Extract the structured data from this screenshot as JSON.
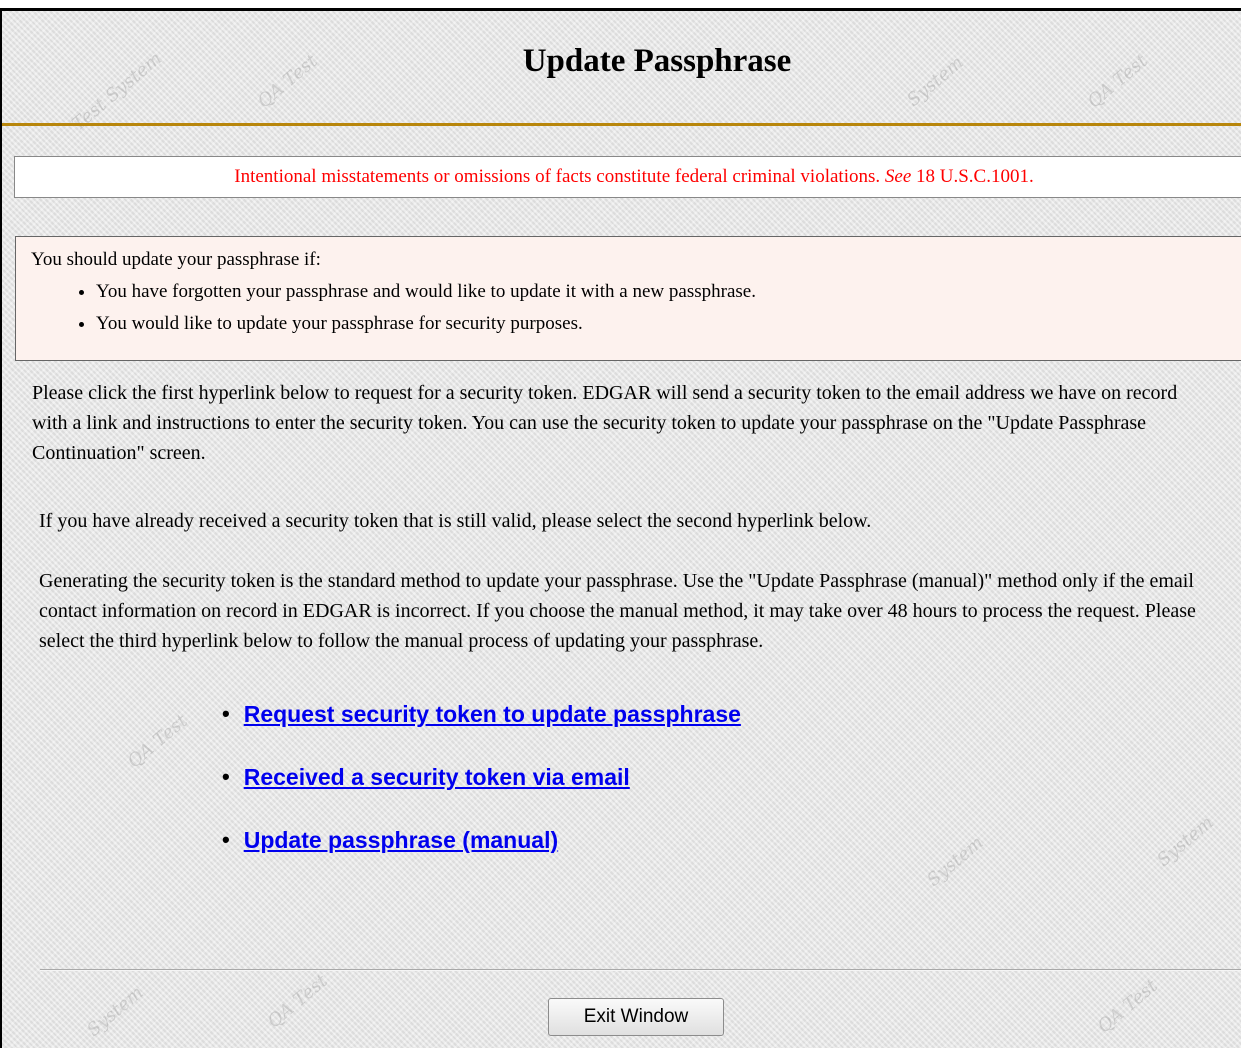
{
  "page": {
    "title": "Update Passphrase",
    "warning": {
      "text": "Intentional misstatements or omissions of facts constitute federal criminal violations. ",
      "see": "See",
      "citation": " 18 U.S.C.1001.",
      "color": "#ff0000"
    },
    "info": {
      "heading": "You should update your passphrase if:",
      "items": [
        "You have forgotten your passphrase and would like to update it with a new passphrase.",
        "You would like to update your passphrase for security purposes."
      ]
    },
    "paragraphs": {
      "p1": "Please click the first hyperlink below to request for a security token. EDGAR will send a security token to the email address we have on record with a link and instructions to enter the security token. You can use the security token to update your passphrase on the \"Update Passphrase Continuation\" screen.",
      "p2": "If you have already received a security token that is still valid, please select the second hyperlink below.",
      "p3": "Generating the security token is the standard method to update your passphrase. Use the \"Update Passphrase (manual)\" method only if the email contact information on record in EDGAR is incorrect. If you choose the manual method, it may take over 48 hours to process the request. Please select the third hyperlink below to follow the manual process of updating your passphrase."
    },
    "links": [
      "Request security token to update passphrase",
      "Received a security token via email",
      "Update passphrase (manual)"
    ],
    "exit_label": "Exit Window",
    "colors": {
      "accent_rule": "#b8860b",
      "link": "#0000ee",
      "info_bg": "#fdf2ee"
    }
  }
}
